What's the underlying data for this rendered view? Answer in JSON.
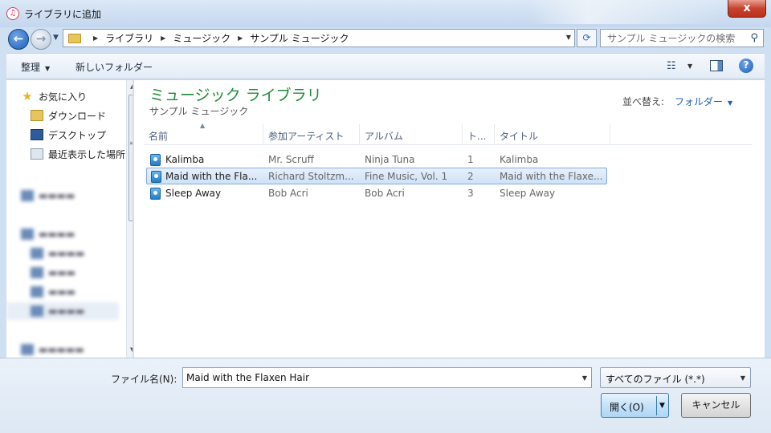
{
  "window": {
    "title": "ライブラリに追加",
    "app_icon": "music-note-icon",
    "close_label": "x"
  },
  "nav": {
    "back_label": "←",
    "forward_label": "→",
    "breadcrumb": [
      "ライブラリ",
      "ミュージック",
      "サンプル ミュージック"
    ],
    "search_placeholder": "サンプル ミュージックの検索",
    "search_icon": "search-icon",
    "refresh_icon": "refresh-icon"
  },
  "toolbar": {
    "organize_label": "整理",
    "new_folder_label": "新しいフォルダー",
    "help_label": "?"
  },
  "navpane": {
    "items": [
      {
        "label": "お気に入り",
        "icon": "star-icon"
      },
      {
        "label": "ダウンロード",
        "icon": "download-folder-icon"
      },
      {
        "label": "デスクトップ",
        "icon": "desktop-icon"
      },
      {
        "label": "最近表示した場所",
        "icon": "recent-places-icon"
      }
    ]
  },
  "library": {
    "title": "ミュージック ライブラリ",
    "subtitle": "サンプル ミュージック",
    "sort_label": "並べ替え:",
    "sort_value": "フォルダー"
  },
  "table": {
    "columns": [
      "名前",
      "参加アーティスト",
      "アルバム",
      "ト...",
      "タイトル"
    ],
    "rows": [
      {
        "name": "Kalimba",
        "artist": "Mr. Scruff",
        "album": "Ninja Tuna",
        "track": "1",
        "title": "Kalimba",
        "selected": false
      },
      {
        "name": "Maid with the Fla...",
        "artist": "Richard Stoltzm...",
        "album": "Fine Music, Vol. 1",
        "track": "2",
        "title": "Maid with the Flaxe...",
        "selected": true
      },
      {
        "name": "Sleep Away",
        "artist": "Bob Acri",
        "album": "Bob Acri",
        "track": "3",
        "title": "Sleep Away",
        "selected": false
      }
    ]
  },
  "footer": {
    "filename_label": "ファイル名(N):",
    "filename_value": "Maid with the Flaxen Hair",
    "filter_value": "すべてのファイル (*.*)",
    "open_label": "開く(O)",
    "cancel_label": "キャンセル"
  },
  "colors": {
    "accent": "#1e8c38",
    "link": "#1a5fb4",
    "selection": "#cfe2f7"
  }
}
